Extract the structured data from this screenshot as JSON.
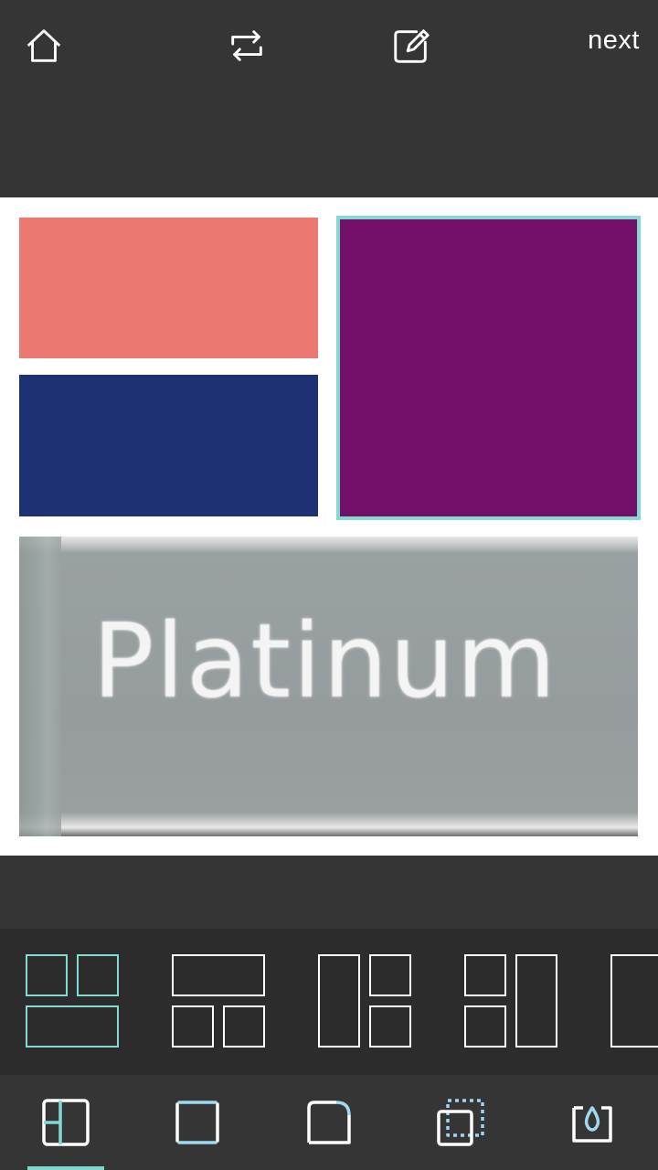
{
  "topbar": {
    "home_icon": "home-icon",
    "swap_icon": "repeat-icon",
    "edit_icon": "edit-icon",
    "next_label": "next"
  },
  "canvas": {
    "tiles": [
      {
        "name": "coral",
        "color": "#ec7872"
      },
      {
        "name": "navy",
        "color": "#1e3273"
      },
      {
        "name": "purple",
        "color": "#720f69",
        "selected": true
      },
      {
        "name": "platinum",
        "text": "Platinum"
      }
    ],
    "selection_color": "#84d9d3"
  },
  "layouts": {
    "selected_index": 0,
    "accent": "#84d9d3",
    "options": [
      "grid-2-top-1-bottom",
      "grid-1-top-2-bottom",
      "grid-1-left-2-right",
      "grid-2-left-1-right",
      "grid-partial"
    ]
  },
  "tabs": {
    "items": [
      "layout-icon",
      "border-icon",
      "corner-radius-icon",
      "spacing-icon",
      "background-color-icon"
    ],
    "selected_index": 0,
    "accent": "#7fd6cf"
  }
}
